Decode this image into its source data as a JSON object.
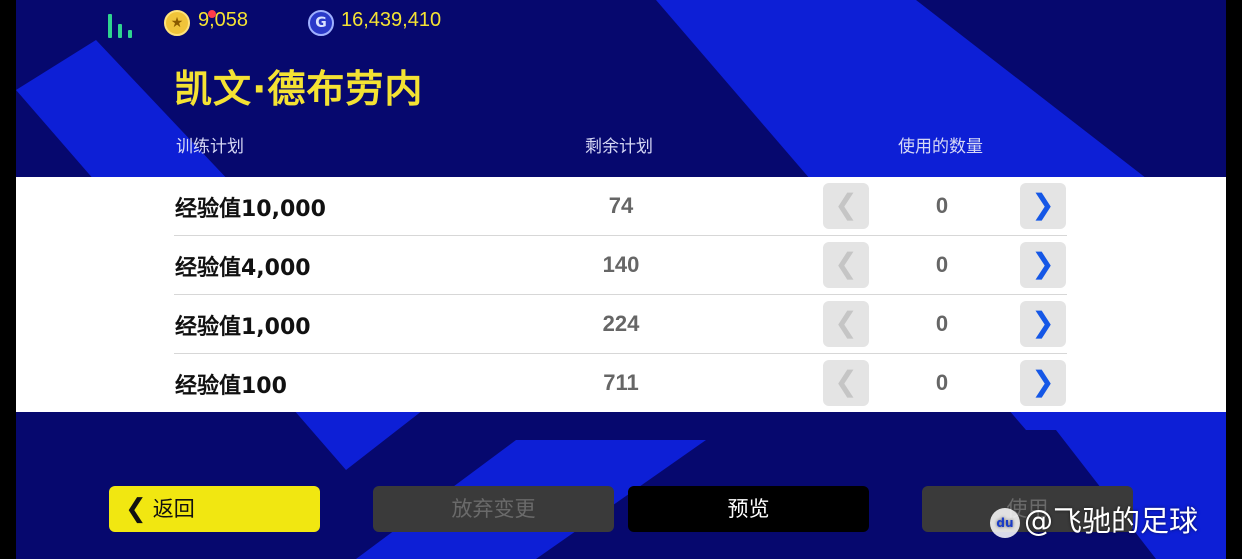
{
  "currency": {
    "coins": "9,058",
    "gp": "16,439,410",
    "coin_icon": "star-coin-icon",
    "gp_icon": "gp-icon"
  },
  "player": {
    "name": "凯文·德布劳内"
  },
  "table": {
    "headers": {
      "plan": "训练计划",
      "remaining": "剩余计划",
      "used": "使用的数量"
    },
    "rows": [
      {
        "name": "经验值10,000",
        "remaining": "74",
        "used": "0"
      },
      {
        "name": "经验值4,000",
        "remaining": "140",
        "used": "0"
      },
      {
        "name": "经验值1,000",
        "remaining": "224",
        "used": "0"
      },
      {
        "name": "经验值100",
        "remaining": "711",
        "used": "0"
      }
    ]
  },
  "footer": {
    "back": "返回",
    "discard": "放弃变更",
    "preview": "预览",
    "confirm": "使用"
  },
  "watermark": "@飞驰的足球",
  "colors": {
    "background": "#06086e",
    "accent_yellow": "#f4e233",
    "stripe_blue": "#0d1fd6",
    "increment_blue": "#1557e6"
  }
}
